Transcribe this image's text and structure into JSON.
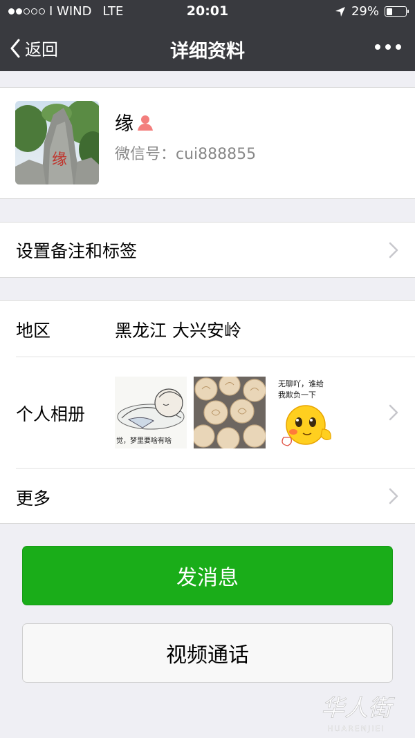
{
  "status_bar": {
    "carrier": "I WIND",
    "network": "LTE",
    "time": "20:01",
    "battery": "29%",
    "battery_level": 0.29,
    "signal_bars": 2,
    "signal_total": 5
  },
  "nav": {
    "back_label": "返回",
    "title": "详细资料"
  },
  "profile": {
    "name": "缘",
    "wechat_id": "微信号：cui888855",
    "avatar_text": "缘"
  },
  "remark_row": {
    "label": "设置备注和标签"
  },
  "region_row": {
    "label": "地区",
    "value": "黑龙江 大兴安岭"
  },
  "album_row": {
    "label": "个人相册",
    "thumbs": [
      {
        "caption": "觉，梦里要啥有啥"
      },
      {
        "caption": ""
      },
      {
        "caption_line1": "无聊吖，谁给",
        "caption_line2": "我欺负一下"
      }
    ]
  },
  "more_row": {
    "label": "更多"
  },
  "buttons": {
    "send_message": "发消息",
    "video_call": "视频通话"
  },
  "watermark": {
    "logo_text": "华人街",
    "sub_text": "HUARENJIEI"
  },
  "colors": {
    "nav_bg": "#393a3f",
    "page_bg": "#efeff4",
    "primary_green": "#1aad19",
    "female_icon": "#f37e7d"
  }
}
